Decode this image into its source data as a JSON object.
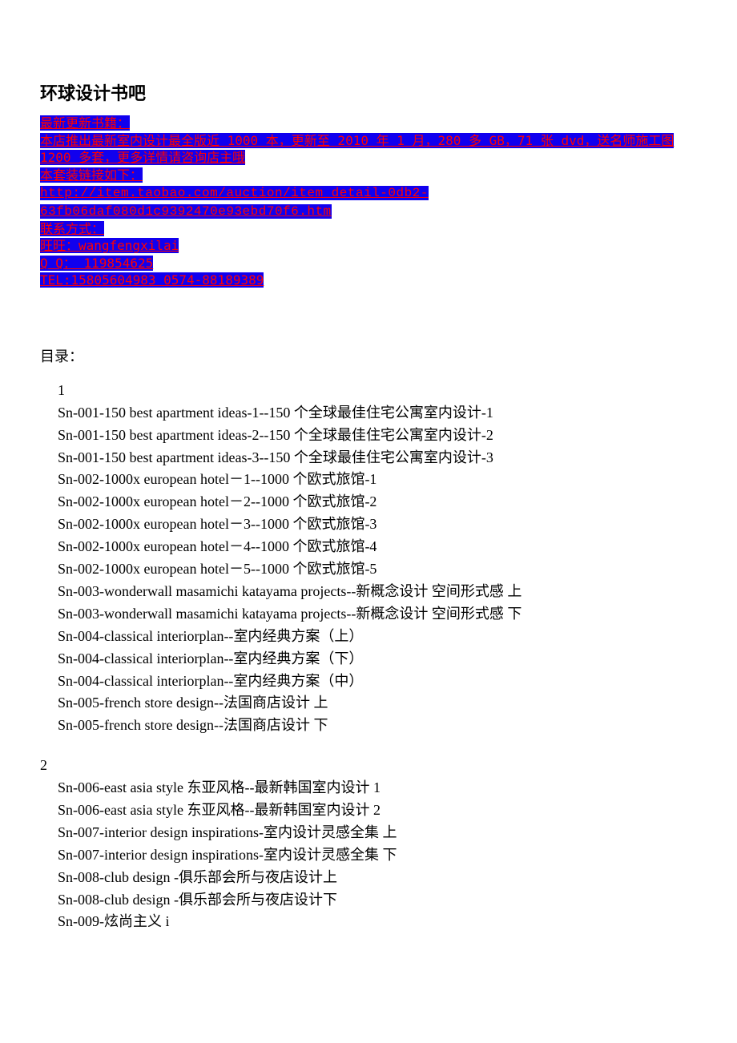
{
  "title": "环球设计书吧",
  "promo": {
    "line1": "最新更新书籍：",
    "line2": "本店推出最新室内设计最全版近 1000 本，更新至 2010 年 1 月，280 多 GB，71 张 dvd，送名师施工图 1200 多套，更多详情请咨询店主哦",
    "line3": "本套装链接如下：",
    "url": " http://item.taobao.com/auction/item_detail-0db2-63fb06daf080d1c9392470e93ebd70f6.htm",
    "contact_label": "联系方式：",
    "wangwang": "   旺旺：wangfengxilai",
    "qq": "   Q Q： 119854625",
    "tel": "TEL:15805604983  0574-88189389"
  },
  "toc_heading": "目录：",
  "section1_num": "1",
  "section1": [
    "Sn-001-150 best apartment ideas-1--150 个全球最佳住宅公寓室内设计-1",
    "Sn-001-150 best apartment ideas-2--150 个全球最佳住宅公寓室内设计-2",
    "Sn-001-150 best apartment ideas-3--150 个全球最佳住宅公寓室内设计-3",
    "Sn-002-1000x european hotel－1--1000 个欧式旅馆-1",
    "Sn-002-1000x european hotel－2--1000 个欧式旅馆-2",
    "Sn-002-1000x european hotel－3--1000 个欧式旅馆-3",
    "Sn-002-1000x european hotel－4--1000 个欧式旅馆-4",
    "Sn-002-1000x european hotel－5--1000 个欧式旅馆-5",
    "Sn-003-wonderwall masamichi katayama projects--新概念设计  空间形式感  上",
    "Sn-003-wonderwall masamichi katayama projects--新概念设计  空间形式感  下",
    "Sn-004-classical interiorplan--室内经典方案（上）",
    "Sn-004-classical interiorplan--室内经典方案（下）",
    "Sn-004-classical interiorplan--室内经典方案（中）",
    "Sn-005-french store design--法国商店设计  上",
    "Sn-005-french store design--法国商店设计  下"
  ],
  "section2_num": "2",
  "section2": [
    "Sn-006-east asia style 东亚风格--最新韩国室内设计 1",
    "Sn-006-east asia style 东亚风格--最新韩国室内设计 2",
    "Sn-007-interior design inspirations-室内设计灵感全集  上",
    "Sn-007-interior design inspirations-室内设计灵感全集  下",
    "Sn-008-club design -俱乐部会所与夜店设计上",
    "Sn-008-club design -俱乐部会所与夜店设计下",
    "Sn-009-炫尚主义 i"
  ]
}
